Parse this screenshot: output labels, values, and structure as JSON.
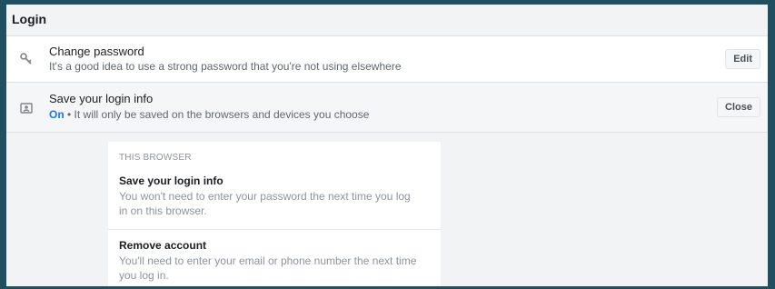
{
  "header": {
    "title": "Login"
  },
  "rows": [
    {
      "icon": "key-icon",
      "title": "Change password",
      "subtitle": "It's a good idea to use a strong password that you're not using elsewhere",
      "action": "Edit"
    },
    {
      "icon": "id-card-icon",
      "title": "Save your login info",
      "status": "On",
      "separator": " • ",
      "subtitle": "It will only be saved on the browsers and devices you choose",
      "action": "Close"
    }
  ],
  "browser_card": {
    "section_label": "THIS BROWSER",
    "items": [
      {
        "title": "Save your login info",
        "description": "You won't need to enter your password the next time you log in on this browser."
      },
      {
        "title": "Remove account",
        "description": "You'll need to enter your email or phone number the next time you log in."
      }
    ]
  },
  "colors": {
    "frame": "#1f4f61",
    "accent": "#1877f2",
    "panel": "#f2f3f5"
  }
}
